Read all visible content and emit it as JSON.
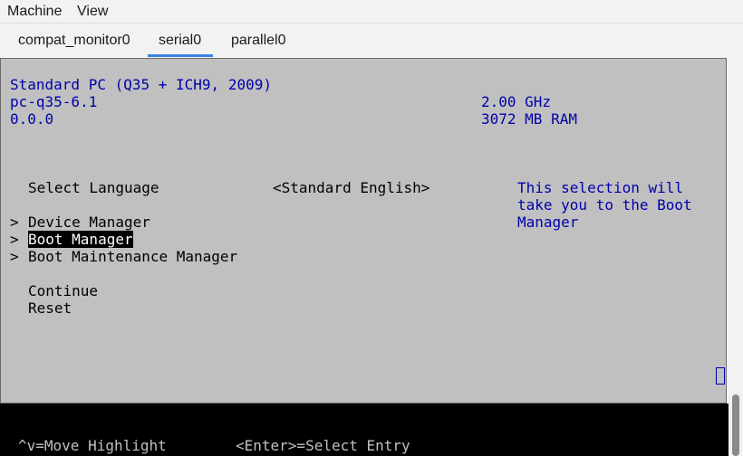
{
  "menu": {
    "machine": "Machine",
    "view": "View"
  },
  "tabs": [
    {
      "label": "compat_monitor0",
      "active": false
    },
    {
      "label": "serial0",
      "active": true
    },
    {
      "label": "parallel0",
      "active": false
    }
  ],
  "terminal": {
    "system_name": "Standard PC (Q35 + ICH9, 2009)",
    "machine_id": "pc-q35-6.1",
    "version": "0.0.0",
    "cpu_speed": "2.00 GHz",
    "ram": "3072 MB RAM",
    "select_language_label": "Select Language",
    "language_value": "<Standard English>",
    "help_line_1": "This selection will",
    "help_line_2": "take you to the Boot",
    "help_line_3": "Manager",
    "arrow": ">",
    "device_manager": "Device Manager",
    "boot_manager": "Boot Manager",
    "boot_maintenance_manager": "Boot Maintenance Manager",
    "continue": "Continue",
    "reset": "Reset"
  },
  "footer": {
    "move_highlight": "^v=Move Highlight",
    "select_entry": "<Enter>=Select Entry"
  },
  "colors": {
    "terminal_bg": "#c0c0c0",
    "terminal_blue_text": "#0000aa",
    "highlight_bg": "#000000",
    "tab_accent": "#3584e4"
  }
}
